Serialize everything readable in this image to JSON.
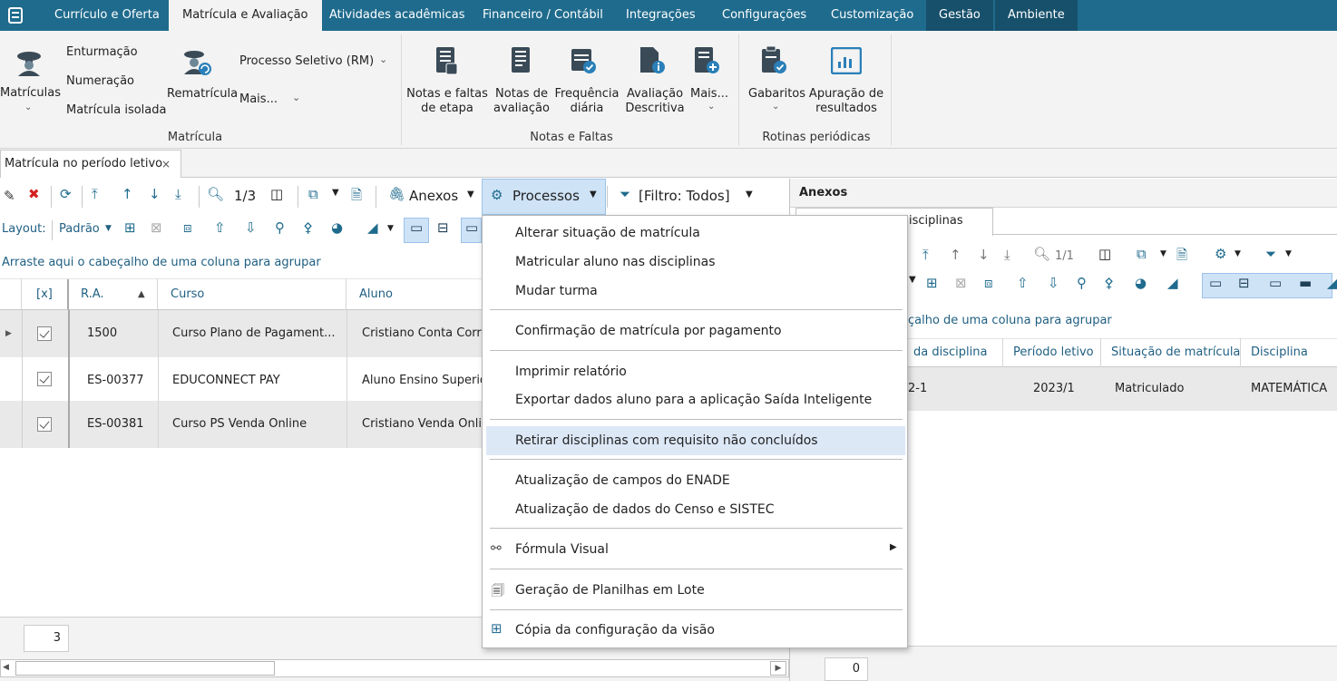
{
  "menu": {
    "tabs": [
      "Currículo e Oferta",
      "Matrícula e Avaliação",
      "Atividades acadêmicas",
      "Financeiro / Contábil",
      "Integrações",
      "Configurações",
      "Customização",
      "Gestão",
      "Ambiente"
    ]
  },
  "ribbon": {
    "matriculas": "Matrículas",
    "enturmacao": "Enturmação",
    "numeracao": "Numeração",
    "matricula_isolada": "Matrícula isolada",
    "rematricula": "Rematrícula",
    "processo_seletivo": "Processo Seletivo (RM)",
    "mais": "Mais...",
    "group_matricula": "Matrícula",
    "notas_faltas_etapa_1": "Notas e faltas",
    "notas_faltas_etapa_2": "de etapa",
    "notas_avaliacao_1": "Notas de",
    "notas_avaliacao_2": "avaliação",
    "frequencia_1": "Frequência",
    "frequencia_2": "diária",
    "avaliacao_desc_1": "Avaliação",
    "avaliacao_desc_2": "Descritiva",
    "mais2": "Mais...",
    "group_notas": "Notas e Faltas",
    "gabaritos": "Gabaritos",
    "apuracao_1": "Apuração de",
    "apuracao_2": "resultados",
    "group_rotinas": "Rotinas periódicas"
  },
  "doc_tab": {
    "label": "Matrícula no período letivo",
    "close": "×"
  },
  "toolbar": {
    "page": "1/3",
    "anexos": "Anexos",
    "processos": "Processos",
    "filtro": "[Filtro: Todos]",
    "layout_label": "Layout:",
    "layout_value": "Padrão"
  },
  "grid": {
    "group_hint": "Arraste aqui o cabeçalho de uma coluna para agrupar",
    "columns": [
      "[x]",
      "R.A.",
      "Curso",
      "Aluno"
    ],
    "rows": [
      {
        "ra": "1500",
        "curso": "Curso Plano de Pagament...",
        "aluno": "Cristiano Conta Corre"
      },
      {
        "ra": "ES-00377",
        "curso": "EDUCONNECT PAY",
        "aluno": "Aluno Ensino Superior"
      },
      {
        "ra": "ES-00381",
        "curso": "Curso PS Venda Online",
        "aluno": "Cristiano Venda Onlin"
      }
    ],
    "count": "3"
  },
  "panel": {
    "title": "Anexos",
    "tab": "isciplinas",
    "page": "1/1",
    "group_hint": "çalho de uma coluna para agrupar",
    "columns": [
      "da disciplina",
      "Período letivo",
      "Situação de matrícula",
      "Disciplina"
    ],
    "row": {
      "c1": "2-1",
      "periodo": "2023/1",
      "situacao": "Matriculado",
      "disciplina": "MATEMÁTICA"
    },
    "count": "0"
  },
  "dropdown": {
    "items": [
      "Alterar situação de matrícula",
      "Matricular aluno nas disciplinas",
      "Mudar turma",
      "Confirmação de matrícula por pagamento",
      "Imprimir relatório",
      "Exportar dados aluno para a aplicação Saída Inteligente",
      "Retirar disciplinas com requisito não concluídos",
      "Atualização de campos do ENADE",
      "Atualização de dados do Censo e SISTEC",
      "Fórmula Visual",
      "Geração de Planilhas em Lote",
      "Cópia da configuração da visão"
    ]
  },
  "colors": {
    "menubar": "#1f6b8d",
    "accent": "#1f5f82",
    "highlight": "#dde8f7"
  }
}
